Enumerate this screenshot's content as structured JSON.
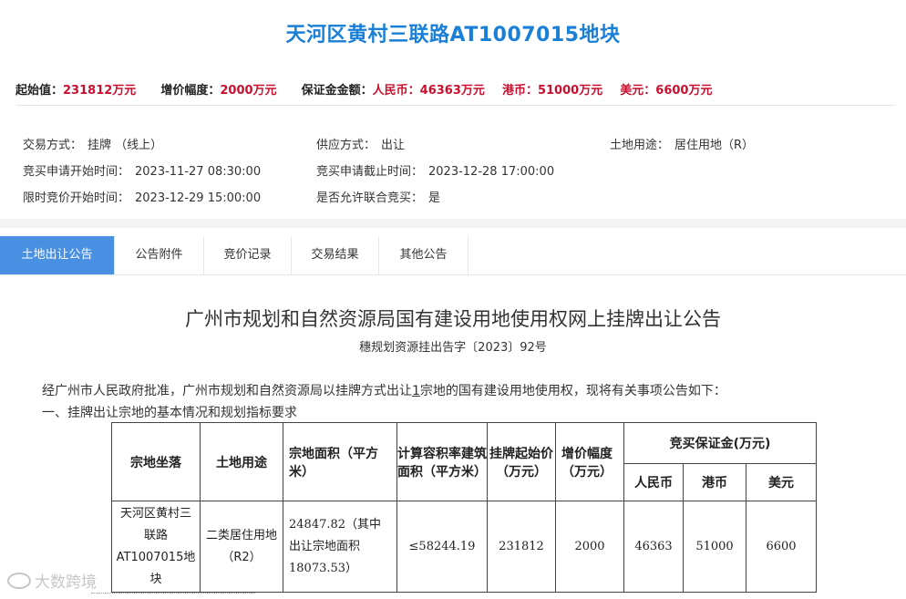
{
  "header": {
    "title": "天河区黄村三联路AT1007015地块"
  },
  "pricebar": {
    "start_label": "起始值：",
    "start_value": "231812万元",
    "increment_label": "增价幅度：",
    "increment_value": "2000万元",
    "deposit_label": "保证金金额：",
    "rmb_label": "人民币：",
    "rmb_value": "46363万元",
    "hkd_label": "港币：",
    "hkd_value": "51000万元",
    "usd_label": "美元：",
    "usd_value": "6600万元"
  },
  "info": {
    "trade_mode_label": "交易方式：",
    "trade_mode_value": "挂牌 （线上）",
    "supply_label": "供应方式：",
    "supply_value": "出让",
    "land_use_label": "土地用途：",
    "land_use_value": "居住用地（R）",
    "apply_start_label": "竞买申请开始时间：",
    "apply_start_value": "2023-11-27 08:30:00",
    "apply_end_label": "竞买申请截止时间：",
    "apply_end_value": "2023-12-28 17:00:00",
    "bid_start_label": "限时竞价开始时间：",
    "bid_start_value": "2023-12-29 15:00:00",
    "joint_label": "是否允许联合竞买：",
    "joint_value": "是"
  },
  "tabs": [
    {
      "label": "土地出让公告",
      "active": true
    },
    {
      "label": "公告附件",
      "active": false
    },
    {
      "label": "竞价记录",
      "active": false
    },
    {
      "label": "交易结果",
      "active": false
    },
    {
      "label": "其他公告",
      "active": false
    }
  ],
  "document": {
    "title": "广州市规划和自然资源局国有建设用地使用权网上挂牌出让公告",
    "subtitle": "穗规划资源挂出告字〔2023〕92号",
    "para1_a": "经广州市人民政府批准，广州市规划和自然资源局以挂牌方式出让",
    "para1_num": "1",
    "para1_b": "宗地的国有建设用地使用权，现将有关事项公告如下：",
    "para2": "一、挂牌出让宗地的基本情况和规划指标要求"
  },
  "table": {
    "headers": {
      "location": "宗地坐落",
      "use": "土地用途",
      "area": "宗地面积（平方米）",
      "gfa": "计算容积率建筑面积（平方米）",
      "start_price": "挂牌起始价（万元）",
      "increment": "增价幅度（万元）",
      "deposit": "竞买保证金(万元)",
      "rmb": "人民币",
      "hkd": "港币",
      "usd": "美元"
    },
    "row": {
      "location": "天河区黄村三联路AT1007015地块",
      "use": "二类居住用地（R2）",
      "area": "24847.82（其中出让宗地面积18073.53）",
      "gfa": "≤58244.19",
      "start_price": "231812",
      "increment": "2000",
      "rmb": "46363",
      "hkd": "51000",
      "usd": "6600"
    }
  },
  "watermark": {
    "text": "大数跨境"
  }
}
